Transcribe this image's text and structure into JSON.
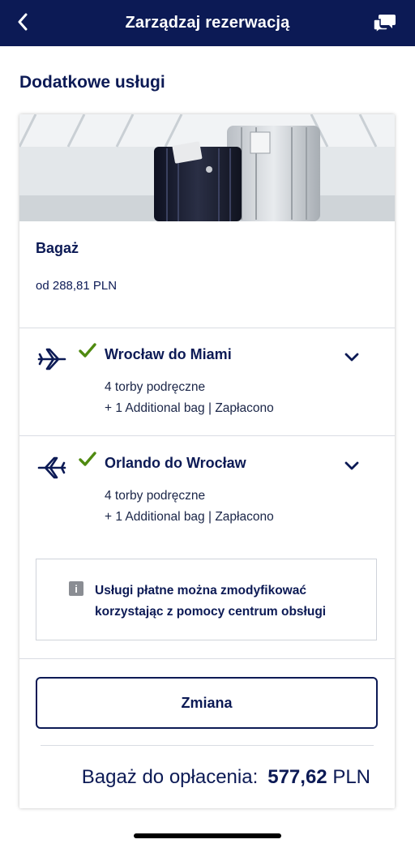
{
  "header": {
    "title": "Zarządzaj rezerwacją",
    "back_icon": "chevron-left-icon",
    "chat_icon": "chat-bubbles-icon",
    "bg_color": "#0c1a55"
  },
  "section_title": "Dodatkowe usługi",
  "baggage": {
    "title": "Bagaż",
    "price": "od 288,81 PLN"
  },
  "flights": [
    {
      "route": "Wrocław do Miami",
      "line1": "4 torby podręczne",
      "line2": "+ 1 Additional bag | Zapłacono",
      "icon": "plane-departure-icon",
      "status": "check-icon"
    },
    {
      "route": "Orlando do Wrocław",
      "line1": "4 torby podręczne",
      "line2": "+ 1 Additional bag | Zapłacono",
      "icon": "plane-return-icon",
      "status": "check-icon"
    }
  ],
  "info": {
    "text": "Usługi płatne można zmodyfikować korzystając z pomocy centrum obsługi",
    "icon": "info-icon"
  },
  "change_button": "Zmiana",
  "total": {
    "label": "Bagaż do opłacenia:",
    "amount": "577,62",
    "currency": "PLN"
  },
  "colors": {
    "navy": "#0c1a55",
    "check_green": "#4f8a10"
  }
}
